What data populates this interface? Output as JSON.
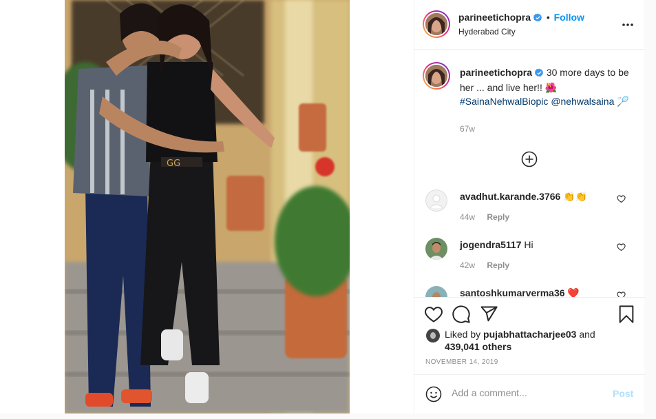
{
  "post": {
    "author": "parineetichopra",
    "follow_label": "Follow",
    "separator": "•",
    "location": "Hyderabad City",
    "more_label": "•••"
  },
  "caption": {
    "author": "parineetichopra",
    "text_part1": "30 more days to be her ... and live her!! 🌺",
    "hashtag": "#SainaNehwalBiopic",
    "mention": "@nehwalsaina",
    "emoji": "🏸",
    "age": "67w"
  },
  "load_more_label": "+",
  "comments": [
    {
      "user": "avadhut.karande.3766",
      "text": "👏👏",
      "age": "44w",
      "reply": "Reply"
    },
    {
      "user": "jogendra5117",
      "text": "Hi",
      "age": "42w",
      "reply": "Reply"
    },
    {
      "user": "santoshkumarverma36",
      "text": "❤️",
      "age": "",
      "reply": ""
    }
  ],
  "likes": {
    "prefix": "Liked by",
    "user": "pujabhattacharjee03",
    "and": "and",
    "count": "439,041 others"
  },
  "date": "NOVEMBER 14, 2019",
  "add_comment": {
    "placeholder": "Add a comment...",
    "post_label": "Post"
  },
  "colors": {
    "link": "#00376b",
    "follow": "#0095f6",
    "post_disabled": "#b2dffc",
    "muted": "#8e8e8e"
  },
  "icons": [
    "verified-icon",
    "more-icon",
    "add-circle-icon",
    "heart-icon",
    "comment-icon",
    "share-icon",
    "save-icon",
    "emoji-icon"
  ]
}
